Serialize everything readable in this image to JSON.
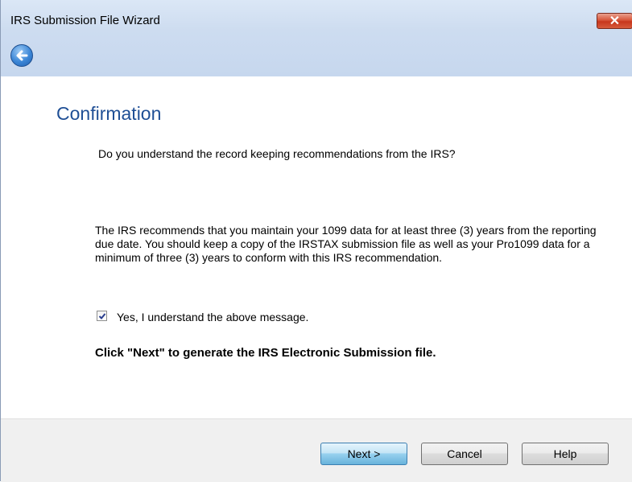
{
  "window": {
    "title": "IRS Submission File Wizard",
    "close_symbol": "✕"
  },
  "nav": {
    "back_icon": "back-arrow-icon"
  },
  "page": {
    "heading": "Confirmation",
    "question": "Do you understand the record keeping recommendations from the IRS?",
    "paragraph": "The IRS recommends that you maintain your 1099 data for at least three (3) years from the reporting due date. You should keep a copy of the IRSTAX submission file as well as your Pro1099 data for a minimum of three (3) years to conform with this IRS recommendation.",
    "checkbox_label": "Yes, I understand the above message.",
    "checkbox_checked": true,
    "instruction": "Click \"Next\" to generate the IRS Electronic Submission file."
  },
  "buttons": {
    "next": "Next >",
    "cancel": "Cancel",
    "help": "Help"
  },
  "colors": {
    "heading": "#1f4f95",
    "titlebar": "#cddcf0",
    "close_button": "#c7361d"
  }
}
